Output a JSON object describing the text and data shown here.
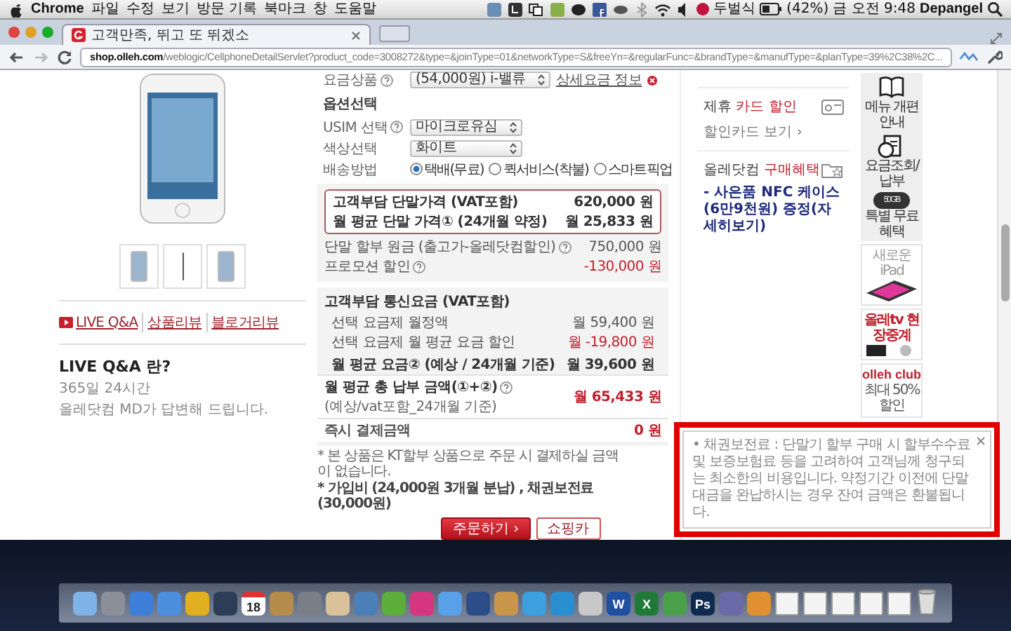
{
  "menu_bar": {
    "app": "Chrome",
    "menus": [
      "파일",
      "수정",
      "보기",
      "방문 기록",
      "북마크",
      "창",
      "도움말"
    ],
    "input_method": "두벌식",
    "battery": "(42%)",
    "clock": "금 오전 9:48",
    "user": "Depangel"
  },
  "browser": {
    "tab_title": "고객만족, 뛰고 또 뛰겠소",
    "url": "**shop.olleh.com**/weblogic/CellphoneDetailServlet?product_code=3008272&type=&joinType=01&networkType=S&freeYn=&regularFunc=&brandType=&manufType=&planType=39%2C38%2C..."
  },
  "links": [
    {
      "label": "LIVE Q&A",
      "kind": "live"
    },
    {
      "label": "상품리뷰",
      "kind": "plain"
    },
    {
      "label": "블로거리뷰",
      "kind": "plain"
    }
  ],
  "live_qa": {
    "title": "LIVE Q&A 란?",
    "lines": [
      "365일 24시간",
      "올레닷컴 MD가 답변해 드립니다."
    ]
  },
  "plan": {
    "label": "요금상품",
    "value": "(54,000원) i-밸류",
    "link": "상세요금 정보"
  },
  "options": {
    "title": "옵션선택",
    "fields": [
      {
        "kind": "select",
        "label": "USIM 선택",
        "help": true,
        "value": "마이크로유심"
      },
      {
        "kind": "select",
        "label": "색상선택",
        "help": false,
        "value": "화이트"
      },
      {
        "kind": "radio",
        "label": "배송방법",
        "help": false,
        "choices": [
          {
            "label": "택배(무료)",
            "selected": true
          },
          {
            "label": "퀵서비스(착불)",
            "selected": false
          },
          {
            "label": "스마트픽업",
            "selected": false
          }
        ]
      }
    ]
  },
  "device_price": {
    "highlight": [
      {
        "label": "고객부담 단말가격 (VAT포함)",
        "value": "620,000 원"
      },
      {
        "label": "월 평균 단말 가격① (24개월 약정)",
        "value": "월 25,833 원"
      }
    ],
    "rows": [
      {
        "label": "단말 할부 원금 (출고가-올레닷컴할인)",
        "help": true,
        "value": "750,000 원",
        "negative": false
      },
      {
        "label": "프로모션 할인",
        "help": true,
        "value": "-130,000 원",
        "negative": true
      }
    ]
  },
  "service_fee": {
    "title": "고객부담 통신요금 (VAT포함)",
    "rows": [
      {
        "label": "선택 요금제 월정액",
        "value": "월 59,400 원",
        "negative": false
      },
      {
        "label": "선택 요금제 월 평균 요금 할인",
        "value": "월 -19,800 원",
        "negative": true
      }
    ],
    "average": {
      "label": "월 평균 요금② (예상 / 24개월 기준)",
      "value": "월 39,600 원"
    },
    "total": {
      "label": "월 평균 총 납부 금액(①+②)",
      "note": "(예상/vat포함_24개월 기준)",
      "value": "월 65,433 원"
    },
    "pay_now": {
      "label": "즉시 결제금액",
      "value": "0 원"
    }
  },
  "notes": [
    "* 본 상품은 KT할부 상품으로 주문 시 결제하실 금액이 없습니다.",
    "* 가입비 (24,000원 3개월 분납) , 채권보전료 (30,000원)"
  ],
  "buttons": [
    {
      "label": "주문하기 ›",
      "kind": "primary"
    },
    {
      "label": "쇼핑카",
      "kind": "secondary"
    }
  ],
  "card_discount": {
    "title": "제휴",
    "title_accent": "카드 할인",
    "link": "할인카드 보기 ›"
  },
  "benefit": {
    "title": "올레닷컴",
    "title_accent": "구매혜택",
    "text": "- 사은품 NFC 케이스(6만9천원) 증정(자세히보기)"
  },
  "quick_menu": [
    {
      "kind": "book",
      "label": "메뉴 개편 안내"
    },
    {
      "kind": "bill",
      "label": "요금조회/납부"
    },
    {
      "kind": "cloud",
      "badge": "50GB",
      "label": "특별 무료혜택"
    }
  ],
  "ads": [
    {
      "kind": "ipad",
      "title": "새로운 iPad"
    },
    {
      "kind": "tv",
      "title": "올레tv 현장중계"
    },
    {
      "kind": "club",
      "title": "olleh club",
      "text": "최대 50% 할인"
    }
  ],
  "notice": {
    "highlighted": true,
    "text": "• 채권보전료 : 단말기 할부 구매 시 할부수수료 및 보증보험료 등을 고려하여 고객님께 청구되는 최소한의 비용입니다. 약정기간 이전에 단말대금을 완납하시는 경우 잔여 금액은 환불됩니다."
  },
  "dock": [
    {
      "kind": "app"
    },
    {
      "kind": "app"
    },
    {
      "kind": "app"
    },
    {
      "kind": "app"
    },
    {
      "kind": "app"
    },
    {
      "kind": "app"
    },
    {
      "kind": "calendar",
      "label": "18"
    },
    {
      "kind": "app"
    },
    {
      "kind": "app"
    },
    {
      "kind": "app"
    },
    {
      "kind": "app"
    },
    {
      "kind": "app"
    },
    {
      "kind": "app"
    },
    {
      "kind": "app"
    },
    {
      "kind": "app"
    },
    {
      "kind": "app"
    },
    {
      "kind": "app"
    },
    {
      "kind": "app"
    },
    {
      "kind": "app"
    },
    {
      "kind": "letter",
      "label": "W"
    },
    {
      "kind": "letter",
      "label": "X"
    },
    {
      "kind": "app"
    },
    {
      "kind": "letter",
      "label": "Ps"
    },
    {
      "kind": "app"
    },
    {
      "kind": "app"
    },
    {
      "kind": "folder"
    },
    {
      "kind": "folder"
    },
    {
      "kind": "folder"
    },
    {
      "kind": "folder"
    },
    {
      "kind": "folder"
    },
    {
      "kind": "trash"
    }
  ]
}
